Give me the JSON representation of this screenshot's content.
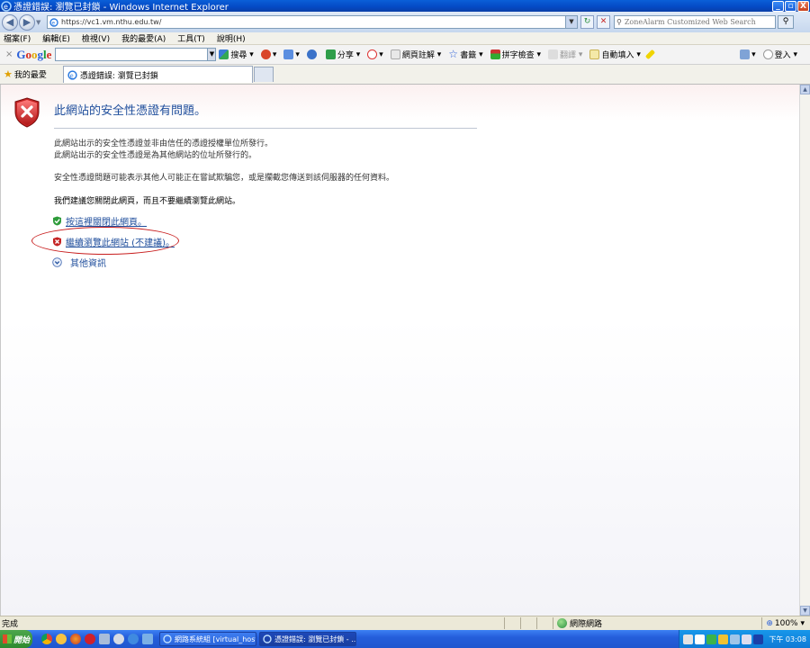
{
  "window": {
    "title": "憑證錯誤: 瀏覽已封鎖 - Windows Internet Explorer",
    "minimize": "_",
    "maximize": "▫",
    "close": "X"
  },
  "address": {
    "url": "https://vc1.vm.nthu.edu.tw/",
    "search_placeholder": "ZoneAlarm Customized Web Search"
  },
  "menu": [
    "檔案(F)",
    "編輯(E)",
    "檢視(V)",
    "我的最愛(A)",
    "工具(T)",
    "說明(H)"
  ],
  "google_toolbar": {
    "logo_parts": [
      "G",
      "o",
      "o",
      "g",
      "l",
      "e"
    ],
    "search_label": "搜尋",
    "share_label": "分享",
    "annotate_label": "網頁註解",
    "bookmarks_label": "書籤",
    "spellcheck_label": "拼字檢查",
    "translate_label": "翻譯",
    "autofill_label": "自動填入",
    "signin_label": "登入"
  },
  "favorites": {
    "label": "我的最愛",
    "tab_title": "憑證錯誤: 瀏覽已封鎖"
  },
  "page": {
    "headline": "此網站的安全性憑證有問題。",
    "line1": "此網站出示的安全性憑證並非由信任的憑證授權單位所發行。",
    "line2": "此網站出示的安全性憑證是為其他網站的位址所發行的。",
    "line3": "安全性憑證問題可能表示其他人可能正在嘗試欺騙您，或是攔截您傳送到該伺服器的任何資料。",
    "recommend": "我們建議您關閉此網頁，而且不要繼續瀏覽此網站。",
    "close_link": "按這裡關閉此網頁。",
    "continue_link": "繼續瀏覽此網站 (不建議)。",
    "more_info": "其他資訊"
  },
  "statusbar": {
    "text": "完成",
    "zone": "網際網路",
    "zoom": "100%"
  },
  "taskbar": {
    "start": "開始",
    "task1": "網路系統組 [virtual_host...",
    "task2": "憑證錯誤: 瀏覽已封鎖 - ...",
    "clock": "下午 03:08"
  },
  "colors": {
    "link_blue": "#1f4e9c",
    "annotation_red": "#c81e1e",
    "titlebar_blue": "#0449c4"
  }
}
